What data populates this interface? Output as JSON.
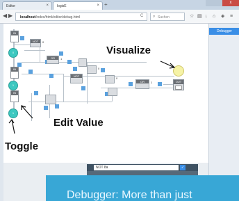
{
  "browser": {
    "tabs": [
      {
        "label": "Editor",
        "close": "×"
      },
      {
        "label": "logisE",
        "close": "×"
      }
    ],
    "new_tab": "+",
    "window_close": "x",
    "nav_back": "◀",
    "nav_forward": "▶",
    "url_domain": "localhost",
    "url_path": "/index/html/editor/debug.html",
    "reload": "C",
    "search_placeholder": "Suchen",
    "toolbar_icons": [
      "star-icon",
      "bookmarks-icon",
      "download-icon",
      "home-icon",
      "shield-icon",
      "menu-icon"
    ],
    "toolbar_glyphs": [
      "☆",
      "▤",
      "↓",
      "⌂",
      "◈",
      "≡"
    ]
  },
  "right_panel": {
    "tab_label": "Debugger"
  },
  "circuit": {
    "gates": [
      "NOT",
      "NOT",
      "OR",
      "AND",
      "OR"
    ],
    "inputs": [
      {
        "label": "IN",
        "state": "0"
      },
      {
        "label": "IN",
        "state": "0"
      },
      {
        "label": "IN",
        "state": "1"
      }
    ],
    "toggle_labels": [
      "0",
      "1",
      "1",
      "1",
      "1"
    ],
    "output_label": "OUT",
    "values": [
      "0",
      "1",
      "0",
      "0",
      "1"
    ]
  },
  "callouts": {
    "visualize": "Visualize",
    "edit_value": "Edit Value",
    "toggle": "Toggle"
  },
  "editor_bar": {
    "input_value": "NOT 8a",
    "ok": "✓"
  },
  "banner": {
    "text": "Debugger: More than just"
  },
  "colors": {
    "accent": "#3a8ee6",
    "toggle": "#3cc8c0",
    "banner": "#38a7d6",
    "bulb": "#f6f3a6"
  }
}
